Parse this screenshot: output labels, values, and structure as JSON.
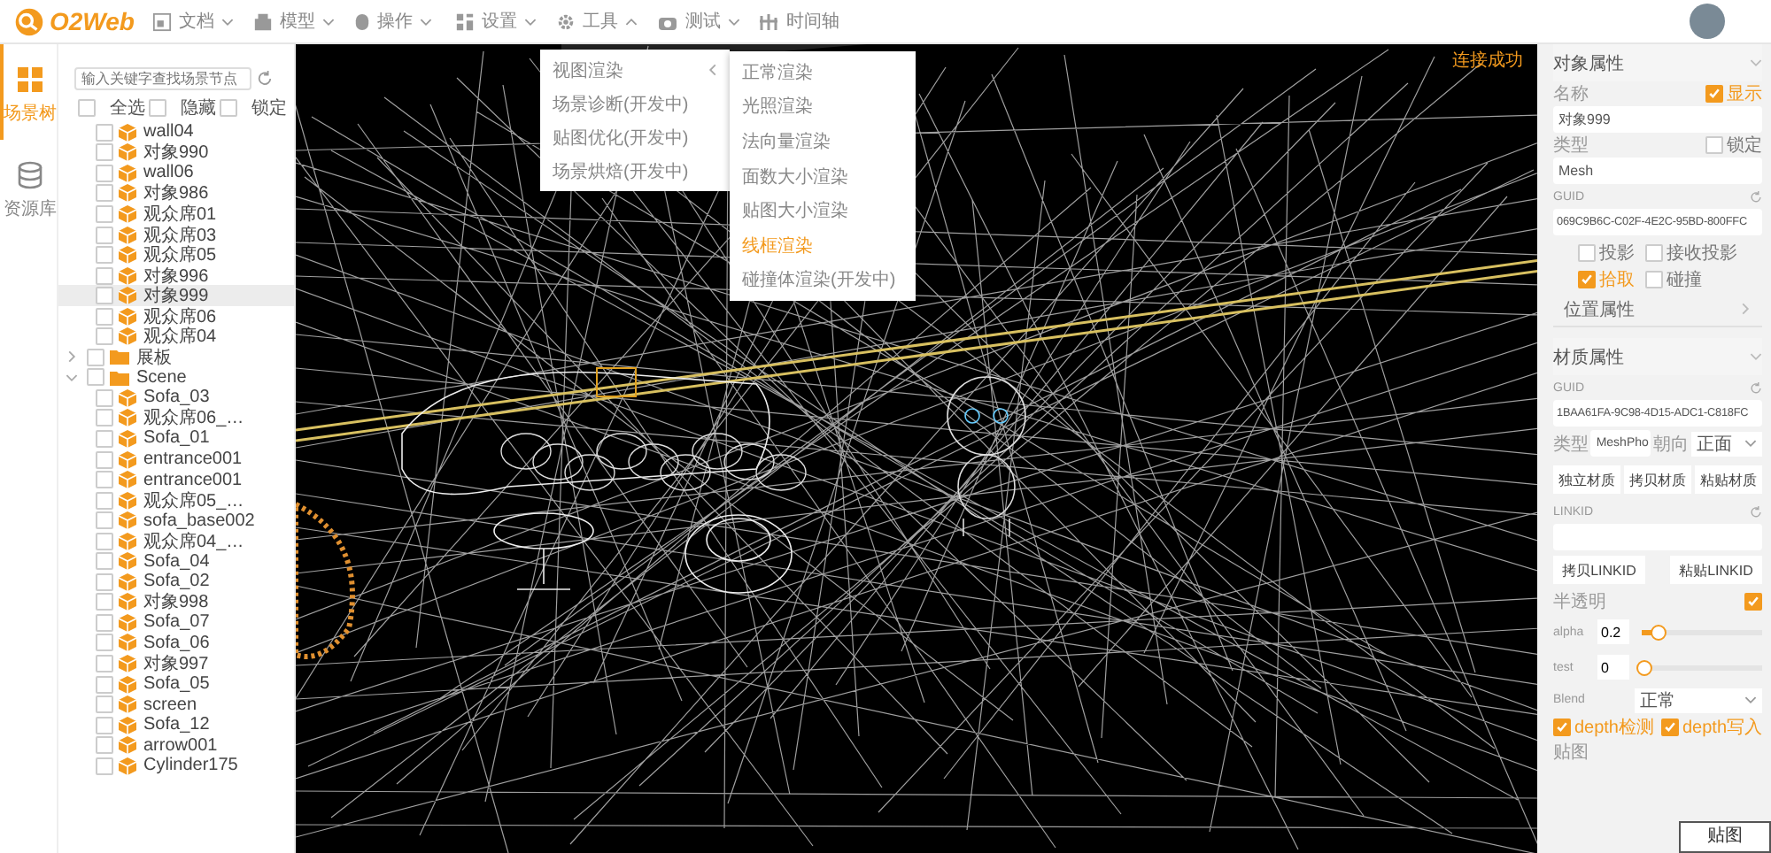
{
  "topbar": {
    "logo": "O2Web",
    "menus": [
      {
        "label": "文档",
        "kind": "dropdown",
        "expanded": false
      },
      {
        "label": "模型",
        "kind": "dropdown",
        "expanded": false
      },
      {
        "label": "操作",
        "kind": "dropdown",
        "expanded": false
      },
      {
        "label": "设置",
        "kind": "dropdown",
        "expanded": false
      },
      {
        "label": "工具",
        "kind": "dropdown",
        "expanded": true
      },
      {
        "label": "测试",
        "kind": "dropdown",
        "expanded": false
      },
      {
        "label": "时间轴",
        "kind": "link"
      }
    ]
  },
  "sidebar": {
    "tabs": [
      {
        "label": "场景树",
        "selected": true
      },
      {
        "label": "资源库",
        "selected": false
      }
    ]
  },
  "tree": {
    "search": {
      "placeholder": "输入关键字查找场景节点"
    },
    "options": [
      {
        "label": "全选",
        "checked": false
      },
      {
        "label": "隐藏",
        "checked": false
      },
      {
        "label": "锁定",
        "checked": false
      }
    ],
    "items": [
      {
        "label": "wall04",
        "kind": "object",
        "checked": false,
        "selected": false
      },
      {
        "label": "对象990",
        "kind": "object",
        "checked": false,
        "selected": false
      },
      {
        "label": "wall06",
        "kind": "object",
        "checked": false,
        "selected": false
      },
      {
        "label": "对象986",
        "kind": "object",
        "checked": false,
        "selected": false
      },
      {
        "label": "观众席01",
        "kind": "object",
        "checked": false,
        "selected": false
      },
      {
        "label": "观众席03",
        "kind": "object",
        "checked": false,
        "selected": false
      },
      {
        "label": "观众席05",
        "kind": "object",
        "checked": false,
        "selected": false
      },
      {
        "label": "对象996",
        "kind": "object",
        "checked": false,
        "selected": false
      },
      {
        "label": "对象999",
        "kind": "object",
        "checked": false,
        "selected": true
      },
      {
        "label": "观众席06",
        "kind": "object",
        "checked": false,
        "selected": false
      },
      {
        "label": "观众席04",
        "kind": "object",
        "checked": false,
        "selected": false
      },
      {
        "label": "展板",
        "kind": "folder",
        "checked": false,
        "selected": false,
        "expanded": false
      },
      {
        "label": "Scene",
        "kind": "folder",
        "checked": false,
        "selected": false,
        "expanded": true,
        "children": [
          {
            "label": "Sofa_03",
            "kind": "object",
            "checked": false,
            "selected": false
          },
          {
            "label": "观众席06_…",
            "kind": "object",
            "checked": false,
            "selected": false
          },
          {
            "label": "Sofa_01",
            "kind": "object",
            "checked": false,
            "selected": false
          },
          {
            "label": "entrance001",
            "kind": "object",
            "checked": false,
            "selected": false
          },
          {
            "label": "entrance001",
            "kind": "object",
            "checked": false,
            "selected": false
          },
          {
            "label": "观众席05_…",
            "kind": "object",
            "checked": false,
            "selected": false
          },
          {
            "label": "sofa_base002",
            "kind": "object",
            "checked": false,
            "selected": false
          },
          {
            "label": "观众席04_…",
            "kind": "object",
            "checked": false,
            "selected": false
          },
          {
            "label": "Sofa_04",
            "kind": "object",
            "checked": false,
            "selected": false
          },
          {
            "label": "Sofa_02",
            "kind": "object",
            "checked": false,
            "selected": false
          },
          {
            "label": "对象998",
            "kind": "object",
            "checked": false,
            "selected": false
          },
          {
            "label": "Sofa_07",
            "kind": "object",
            "checked": false,
            "selected": false
          },
          {
            "label": "Sofa_06",
            "kind": "object",
            "checked": false,
            "selected": false
          },
          {
            "label": "对象997",
            "kind": "object",
            "checked": false,
            "selected": false
          },
          {
            "label": "Sofa_05",
            "kind": "object",
            "checked": false,
            "selected": false
          },
          {
            "label": "screen",
            "kind": "object",
            "checked": false,
            "selected": false
          },
          {
            "label": "Sofa_12",
            "kind": "object",
            "checked": false,
            "selected": false
          },
          {
            "label": "arrow001",
            "kind": "object",
            "checked": false,
            "selected": false
          },
          {
            "label": "Cylinder175",
            "kind": "object",
            "checked": false,
            "selected": false
          }
        ]
      }
    ]
  },
  "viewport": {
    "status": "连接成功",
    "menu": [
      {
        "label": "视图渲染",
        "kind": "submenu"
      },
      {
        "label": "场景诊断(开发中)",
        "kind": "item"
      },
      {
        "label": "贴图优化(开发中)",
        "kind": "item"
      },
      {
        "label": "场景烘焙(开发中)",
        "kind": "item"
      }
    ],
    "submenu": [
      {
        "label": "正常渲染",
        "selected": false
      },
      {
        "label": "光照渲染",
        "selected": false
      },
      {
        "label": "法向量渲染",
        "selected": false
      },
      {
        "label": "面数大小渲染",
        "selected": false
      },
      {
        "label": "贴图大小渲染",
        "selected": false
      },
      {
        "label": "线框渲染",
        "selected": true
      },
      {
        "label": "碰撞体渲染(开发中)",
        "selected": false
      }
    ]
  },
  "object_props": {
    "title": "对象属性",
    "expanded": true,
    "name_label": "名称",
    "visible": {
      "label": "显示",
      "checked": true
    },
    "name_value": "对象999",
    "type_label": "类型",
    "lock": {
      "label": "锁定",
      "checked": false
    },
    "type_value": "Mesh",
    "guid_label": "GUID",
    "guid_value": "069C9B6C-C02F-4E2C-95BD-800FFC",
    "flags": [
      {
        "label": "投影",
        "checked": false
      },
      {
        "label": "接收投影",
        "checked": false
      },
      {
        "label": "拾取",
        "checked": true
      },
      {
        "label": "碰撞",
        "checked": false
      }
    ],
    "position_title": "位置属性"
  },
  "material_props": {
    "title": "材质属性",
    "expanded": true,
    "guid_label": "GUID",
    "guid_value": "1BAA61FA-9C98-4D15-ADC1-C818FC",
    "type_label": "类型",
    "type_value": "MeshPho",
    "facing_label": "朝向",
    "facing_value": "正面",
    "buttons": [
      "独立材质",
      "拷贝材质",
      "粘贴材质"
    ],
    "linkid_label": "LINKID",
    "linkid_buttons": [
      "拷贝LINKID",
      "粘贴LINKID"
    ],
    "transparent": {
      "label": "半透明",
      "checked": true
    },
    "sliders": [
      {
        "label": "alpha",
        "value": "0.2",
        "level": 0.12
      },
      {
        "label": "test",
        "value": "0",
        "level": 0
      }
    ],
    "blend_label": "Blend",
    "blend_value": "正常",
    "depth": [
      {
        "label": "depth检测",
        "checked": true
      },
      {
        "label": "depth写入",
        "checked": true
      }
    ],
    "map_label": "贴图",
    "map_popup": "贴图"
  }
}
